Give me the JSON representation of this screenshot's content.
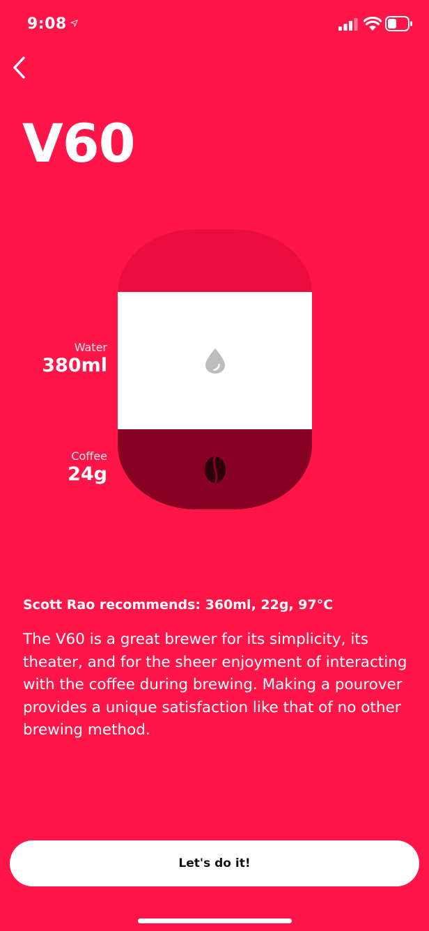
{
  "status_bar": {
    "time": "9:08"
  },
  "navigation": {
    "back_icon": "chevron-left-icon"
  },
  "page": {
    "title": "V60"
  },
  "brew": {
    "water": {
      "label": "Water",
      "value": "380ml",
      "icon": "water-drop-icon"
    },
    "coffee": {
      "label": "Coffee",
      "value": "24g",
      "icon": "coffee-bean-icon"
    }
  },
  "info": {
    "recommendation": "Scott Rao recommends: 360ml, 22g, 97°C",
    "description": "The V60 is a great brewer for its simplicity, its theater, and for the sheer enjoyment of interacting with the coffee during brewing. Making a pourover provides a unique satisfaction like that of no other brewing method."
  },
  "actions": {
    "primary_label": "Let's do it!"
  },
  "colors": {
    "background": "#FF1547",
    "top_zone": "#E90E3E",
    "water_zone": "#FFFFFF",
    "coffee_zone": "#880022",
    "button_text": "#111111"
  }
}
